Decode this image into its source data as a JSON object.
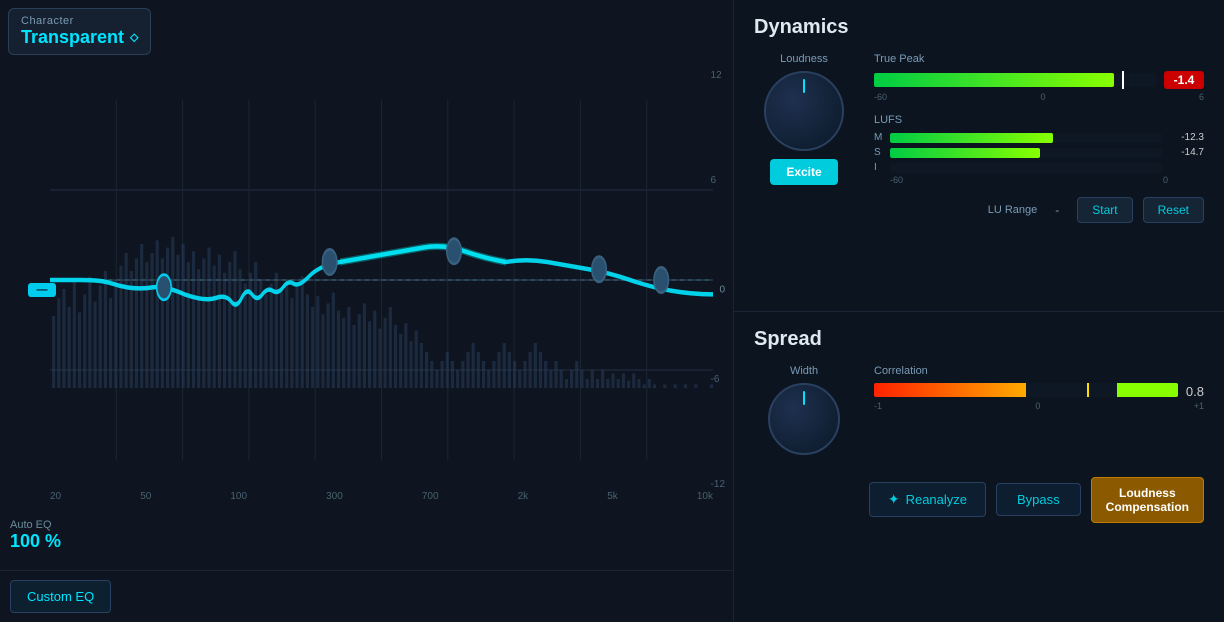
{
  "character": {
    "label": "Character",
    "value": "Transparent"
  },
  "autoeq": {
    "label": "Auto EQ",
    "value": "100 %"
  },
  "customEq": {
    "label": "Custom EQ"
  },
  "eq": {
    "freqLabels": [
      "20",
      "50",
      "100",
      "300",
      "700",
      "2k",
      "5k",
      "10k"
    ],
    "dbLabels": [
      "12",
      "6",
      "0",
      "-6",
      "-12"
    ],
    "zeroLabel": "0"
  },
  "dynamics": {
    "title": "Dynamics",
    "loudness": {
      "label": "Loudness"
    },
    "exciteBtn": "Excite",
    "truePeak": {
      "label": "True Peak",
      "value": "-1.4",
      "scaleMin": "-60",
      "scaleZero": "0",
      "scaleMax": "6",
      "fillPercent": 85
    },
    "lufs": {
      "label": "LUFS",
      "channels": [
        {
          "ch": "M",
          "value": "-12.3",
          "fillPercent": 60
        },
        {
          "ch": "S",
          "value": "-14.7",
          "fillPercent": 55
        },
        {
          "ch": "I",
          "value": "",
          "fillPercent": 0
        }
      ],
      "scaleMin": "-60",
      "scaleZero": "0"
    },
    "luRange": {
      "label": "LU Range",
      "value": "-"
    },
    "startBtn": "Start",
    "resetBtn": "Reset"
  },
  "spread": {
    "title": "Spread",
    "width": {
      "label": "Width"
    },
    "correlation": {
      "label": "Correlation",
      "value": "0.8",
      "scaleMin": "-1",
      "scaleZero": "0",
      "scaleMax": "+1"
    }
  },
  "bottomBar": {
    "reanalyzeBtn": "Reanalyze",
    "bypassBtn": "Bypass",
    "loudnessCompBtn": "Loudness\nCompensation"
  }
}
